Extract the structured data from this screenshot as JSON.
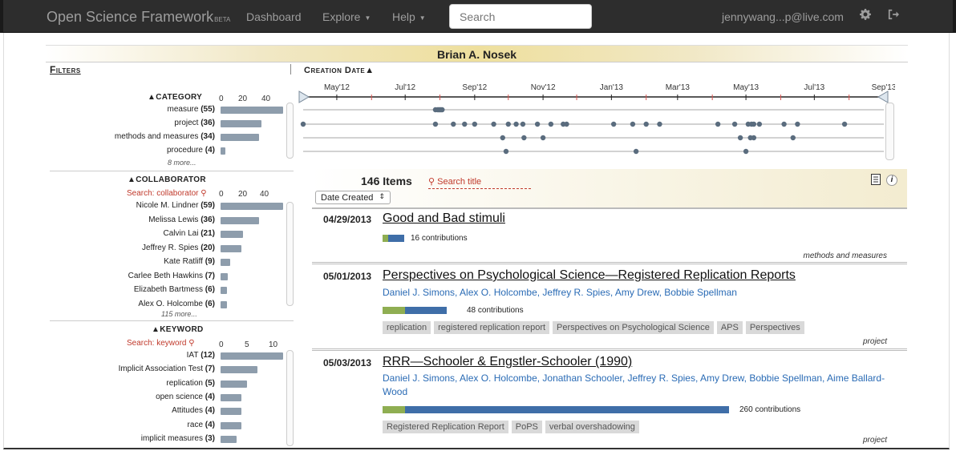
{
  "nav": {
    "brand": "Open Science Framework",
    "brand_tag": "BETA",
    "dashboard": "Dashboard",
    "explore": "Explore",
    "help": "Help",
    "search_placeholder": "Search",
    "user": "jennywang...p@live.com",
    "settings_icon": "gear-icon",
    "logout_icon": "sign-out-icon"
  },
  "page_title": "Brian A. Nosek",
  "filters": {
    "heading": "Filters",
    "category": {
      "title": "▲CATEGORY",
      "ticks": [
        "0",
        "20",
        "40"
      ],
      "max": 55,
      "items": [
        {
          "label": "measure",
          "count": 55
        },
        {
          "label": "project",
          "count": 36
        },
        {
          "label": "methods and measures",
          "count": 34
        },
        {
          "label": "procedure",
          "count": 4
        }
      ],
      "more": "8 more..."
    },
    "collaborator": {
      "title": "▲COLLABORATOR",
      "search": "Search: collaborator",
      "ticks": [
        "0",
        "20",
        "40"
      ],
      "max": 59,
      "items": [
        {
          "label": "Nicole M. Lindner",
          "count": 59
        },
        {
          "label": "Melissa Lewis",
          "count": 36
        },
        {
          "label": "Calvin Lai",
          "count": 21
        },
        {
          "label": "Jeffrey R. Spies",
          "count": 20
        },
        {
          "label": "Kate Ratliff",
          "count": 9
        },
        {
          "label": "Carlee Beth Hawkins",
          "count": 7
        },
        {
          "label": "Elizabeth Bartmess",
          "count": 6
        },
        {
          "label": "Alex O. Holcombe",
          "count": 6
        }
      ],
      "more": "115 more..."
    },
    "keyword": {
      "title": "▲KEYWORD",
      "search": "Search: keyword",
      "ticks": [
        "0",
        "5",
        "10"
      ],
      "max": 12,
      "items": [
        {
          "label": "IAT",
          "count": 12
        },
        {
          "label": "Implicit Association Test",
          "count": 7
        },
        {
          "label": "replication",
          "count": 5
        },
        {
          "label": "open science",
          "count": 4
        },
        {
          "label": "Attitudes",
          "count": 4
        },
        {
          "label": "race",
          "count": 4
        },
        {
          "label": "implicit measures",
          "count": 3
        }
      ]
    }
  },
  "creation_date": {
    "heading": "Creation Date▲",
    "months": [
      "May'12",
      "Jul'12",
      "Sep'12",
      "Nov'12",
      "Jan'13",
      "Mar'13",
      "May'13",
      "Jul'13",
      "Sep'13"
    ],
    "rows": [
      [
        "2012-07-28",
        "2012-07-30",
        "2012-07-31",
        "2012-08-01",
        "2012-08-02",
        "2012-08-03"
      ],
      [
        "2012-04-01",
        "2012-07-28",
        "2012-08-13",
        "2012-08-23",
        "2012-09-01",
        "2012-09-18",
        "2012-10-01",
        "2012-10-08",
        "2012-10-14",
        "2012-10-27",
        "2012-11-08",
        "2012-11-19",
        "2012-11-22",
        "2013-01-03",
        "2013-01-20",
        "2013-02-01",
        "2013-02-13",
        "2013-04-06",
        "2013-04-21",
        "2013-05-03",
        "2013-05-06",
        "2013-05-08",
        "2013-05-13",
        "2013-06-04",
        "2013-06-16",
        "2013-07-28"
      ],
      [
        "2012-09-26",
        "2012-10-15",
        "2012-11-01",
        "2013-04-26",
        "2013-05-05",
        "2013-05-08",
        "2013-06-12"
      ],
      [
        "2012-09-29",
        "2013-01-23",
        "2013-05-01"
      ]
    ]
  },
  "list": {
    "count": "146 Items",
    "search_title": "Search title",
    "sort": "Date Created",
    "items": [
      {
        "date": "04/29/2013",
        "title": "Good and Bad stimuli",
        "authors": "",
        "contributions": 16,
        "contrib_text": "16 contributions",
        "tags": [],
        "category": "methods and measures"
      },
      {
        "date": "05/01/2013",
        "title": "Perspectives on Psychological Science—Registered Replication Reports",
        "authors": "Daniel J. Simons, Alex O. Holcombe, Jeffrey R. Spies, Amy Drew, Bobbie Spellman",
        "contributions": 48,
        "contrib_text": "48 contributions",
        "tags": [
          "replication",
          "registered replication report",
          "Perspectives on Psychological Science",
          "APS",
          "Perspectives"
        ],
        "category": "project"
      },
      {
        "date": "05/03/2013",
        "title": "RRR—Schooler & Engstler-Schooler (1990)",
        "authors": "Daniel J. Simons, Alex O. Holcombe, Jonathan Schooler, Jeffrey R. Spies, Amy Drew, Bobbie Spellman, Aime Ballard-Wood",
        "contributions": 260,
        "contrib_text": "260 contributions",
        "tags": [
          "Registered Replication Report",
          "PoPS",
          "verbal overshadowing"
        ],
        "category": "project"
      }
    ]
  }
}
